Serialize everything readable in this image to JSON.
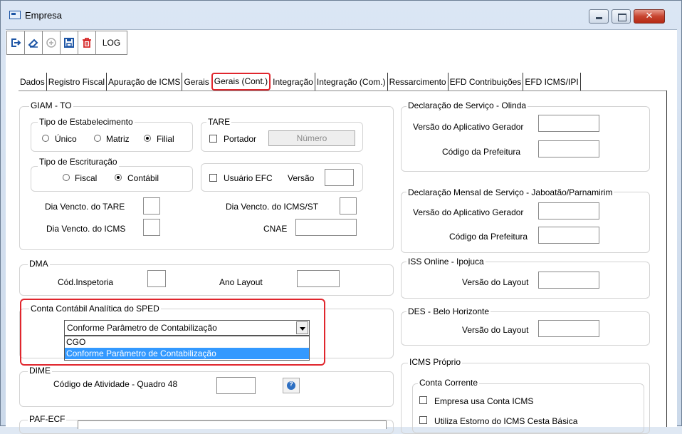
{
  "window": {
    "title": "Empresa",
    "close_glyph": "✕"
  },
  "toolbar": {
    "buttons": [
      "exit-icon",
      "eraser-icon",
      "add-icon",
      "save-icon",
      "delete-icon"
    ],
    "log_label": "LOG"
  },
  "tabs": [
    "Dados",
    "Registro Fiscal",
    "Apuração de ICMS",
    "Gerais",
    "Gerais (Cont.)",
    "Integração",
    "Integração (Com.)",
    "Ressarcimento",
    "EFD Contribuições",
    "EFD ICMS/IPI"
  ],
  "giam": {
    "legend": "GIAM - TO",
    "tipo_estab": {
      "legend": "Tipo de Estabelecimento",
      "options": [
        "Único",
        "Matriz",
        "Filial"
      ],
      "selected": "Filial"
    },
    "tare": {
      "legend": "TARE",
      "portador_label": "Portador",
      "numero_button": "Número"
    },
    "tipo_escrit": {
      "legend": "Tipo de Escrituração",
      "options": [
        "Fiscal",
        "Contábil"
      ],
      "selected": "Contábil"
    },
    "usuario_efc_label": "Usuário EFC",
    "versao_label": "Versão",
    "dia_tare_label": "Dia Vencto. do TARE",
    "dia_icms_st_label": "Dia Vencto. do ICMS/ST",
    "dia_icms_label": "Dia Vencto. do ICMS",
    "cnae_label": "CNAE"
  },
  "dma": {
    "legend": "DMA",
    "cod_inspetoria_label": "Cód.Inspetoria",
    "ano_layout_label": "Ano Layout"
  },
  "sped": {
    "legend": "Conta Contábil Analítica do SPED",
    "selected": "Conforme Parâmetro de Contabilização",
    "options": [
      "CGO",
      "Conforme Parâmetro de Contabilização"
    ]
  },
  "dime": {
    "legend": "DIME",
    "codigo_label": "Código de Atividade - Quadro 48",
    "help_glyph": "?"
  },
  "paf": {
    "legend": "PAF-ECF"
  },
  "olinda": {
    "legend": "Declaração de Serviço - Olinda",
    "versao_label": "Versão do Aplicativo Gerador",
    "codigo_label": "Código da Prefeitura"
  },
  "jaboatao": {
    "legend": "Declaração Mensal de Serviço - Jaboatão/Parnamirim",
    "versao_label": "Versão do Aplicativo Gerador",
    "codigo_label": "Código da Prefeitura"
  },
  "ipojuca": {
    "legend": "ISS Online - Ipojuca",
    "versao_label": "Versão do Layout"
  },
  "bh": {
    "legend": "DES - Belo Horizonte",
    "versao_label": "Versão do Layout"
  },
  "icms_proprio": {
    "legend": "ICMS Próprio",
    "conta_corrente_legend": "Conta Corrente",
    "empresa_usa_label": "Empresa usa Conta ICMS",
    "estorno_label": "Utiliza Estorno do ICMS Cesta Básica"
  }
}
